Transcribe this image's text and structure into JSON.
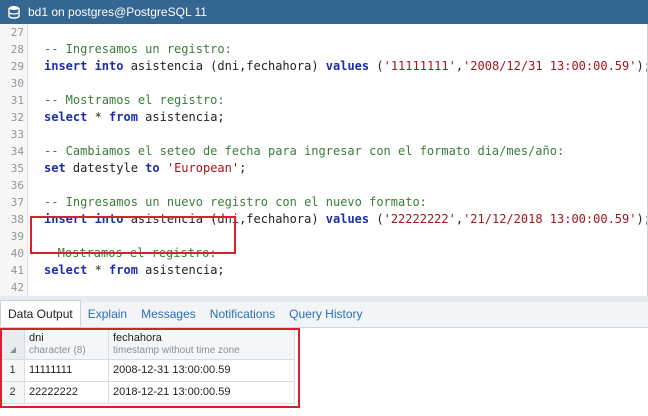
{
  "window": {
    "title": "bd1 on postgres@PostgreSQL 11"
  },
  "editor": {
    "lines": [
      {
        "num": "27",
        "parts": []
      },
      {
        "num": "28",
        "parts": [
          {
            "t": "comment",
            "v": "-- Ingresamos un registro:"
          }
        ]
      },
      {
        "num": "29",
        "parts": [
          {
            "t": "kw",
            "v": "insert into"
          },
          {
            "t": "plain",
            "v": " asistencia (dni,fechahora) "
          },
          {
            "t": "kw",
            "v": "values"
          },
          {
            "t": "plain",
            "v": " ("
          },
          {
            "t": "str",
            "v": "'11111111'"
          },
          {
            "t": "plain",
            "v": ","
          },
          {
            "t": "str",
            "v": "'2008/12/31 13:00:00.59'"
          },
          {
            "t": "plain",
            "v": ");"
          }
        ]
      },
      {
        "num": "30",
        "parts": []
      },
      {
        "num": "31",
        "parts": [
          {
            "t": "comment",
            "v": "-- Mostramos el registro:"
          }
        ]
      },
      {
        "num": "32",
        "parts": [
          {
            "t": "kw",
            "v": "select"
          },
          {
            "t": "plain",
            "v": " * "
          },
          {
            "t": "kw",
            "v": "from"
          },
          {
            "t": "plain",
            "v": " asistencia;"
          }
        ]
      },
      {
        "num": "33",
        "parts": []
      },
      {
        "num": "34",
        "parts": [
          {
            "t": "comment",
            "v": "-- Cambiamos el seteo de fecha para ingresar con el formato dia/mes/año:"
          }
        ]
      },
      {
        "num": "35",
        "parts": [
          {
            "t": "kw",
            "v": "set"
          },
          {
            "t": "plain",
            "v": " datestyle "
          },
          {
            "t": "kw",
            "v": "to"
          },
          {
            "t": "plain",
            "v": " "
          },
          {
            "t": "str",
            "v": "'European'"
          },
          {
            "t": "plain",
            "v": ";"
          }
        ]
      },
      {
        "num": "36",
        "parts": []
      },
      {
        "num": "37",
        "parts": [
          {
            "t": "comment",
            "v": "-- Ingresamos un nuevo registro con el nuevo formato:"
          }
        ]
      },
      {
        "num": "38",
        "parts": [
          {
            "t": "kw",
            "v": "insert into"
          },
          {
            "t": "plain",
            "v": " asistencia (dni,fechahora) "
          },
          {
            "t": "kw",
            "v": "values"
          },
          {
            "t": "plain",
            "v": " ("
          },
          {
            "t": "str",
            "v": "'22222222'"
          },
          {
            "t": "plain",
            "v": ","
          },
          {
            "t": "str",
            "v": "'21/12/2018 13:00:00.59'"
          },
          {
            "t": "plain",
            "v": ");"
          }
        ]
      },
      {
        "num": "39",
        "parts": []
      },
      {
        "num": "40",
        "parts": [
          {
            "t": "comment",
            "v": "-- Mostramos el registro:"
          }
        ]
      },
      {
        "num": "41",
        "parts": [
          {
            "t": "kw",
            "v": "select"
          },
          {
            "t": "plain",
            "v": " * "
          },
          {
            "t": "kw",
            "v": "from"
          },
          {
            "t": "plain",
            "v": " asistencia;"
          }
        ]
      },
      {
        "num": "42",
        "parts": []
      }
    ]
  },
  "tabs": [
    "Data Output",
    "Explain",
    "Messages",
    "Notifications",
    "Query History"
  ],
  "results": {
    "columns": [
      {
        "name": "dni",
        "type": "character (8)"
      },
      {
        "name": "fechahora",
        "type": "timestamp without time zone"
      }
    ],
    "rows": [
      {
        "n": "1",
        "cells": [
          "11111111",
          "2008-12-31 13:00:00.59"
        ]
      },
      {
        "n": "2",
        "cells": [
          "22222222",
          "2018-12-21 13:00:00.59"
        ]
      }
    ]
  },
  "colors": {
    "titlebar": "#336791",
    "highlight_box": "#d9202e",
    "keyword": "#1c2fa8",
    "comment": "#3b7d3b",
    "string": "#a3151a",
    "tab_link": "#2c6fb6"
  },
  "icons": {
    "title": "database-icon"
  }
}
